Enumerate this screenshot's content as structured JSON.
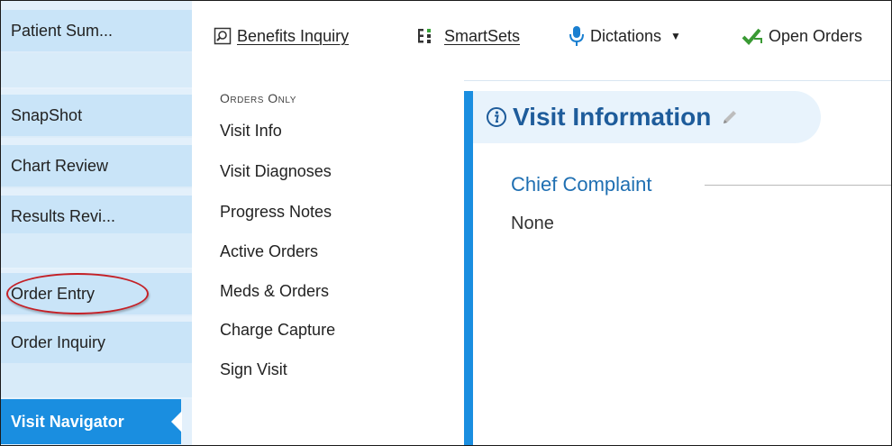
{
  "sidebar": {
    "items": [
      {
        "label": "Patient Sum..."
      },
      {
        "label": "SnapShot"
      },
      {
        "label": "Chart Review"
      },
      {
        "label": "Results Revi..."
      },
      {
        "label": "Order Entry"
      },
      {
        "label": "Order Inquiry"
      }
    ],
    "active": "Visit Navigator"
  },
  "toolbar": {
    "benefits": "Benefits Inquiry",
    "smartsets": "SmartSets",
    "dictations": "Dictations",
    "open_orders": "Open Orders"
  },
  "nav": {
    "header": "Orders Only",
    "items": [
      "Visit Info",
      "Visit Diagnoses",
      "Progress Notes",
      "Active Orders",
      "Meds & Orders",
      "Charge Capture",
      "Sign Visit"
    ]
  },
  "content": {
    "section_title": "Visit Information",
    "field_label": "Chief Complaint",
    "field_value": "None"
  },
  "colors": {
    "accent": "#1a8ee0",
    "highlight_oval": "#c42026"
  }
}
